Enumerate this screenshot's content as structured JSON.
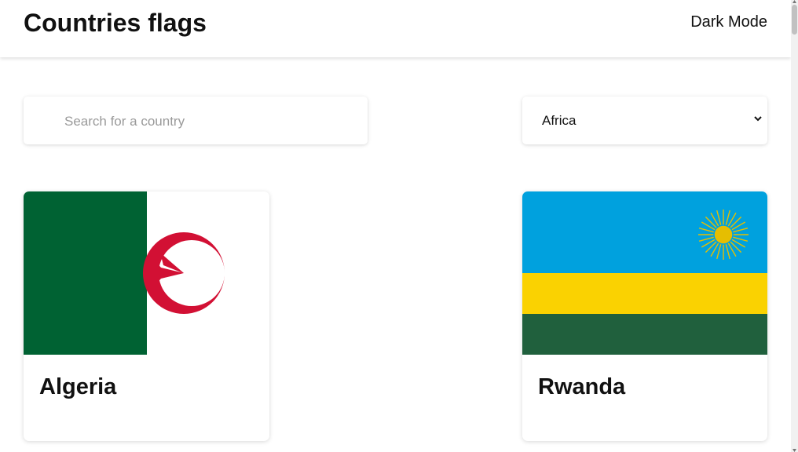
{
  "header": {
    "title": "Countries flags",
    "dark_mode_label": "Dark Mode"
  },
  "search": {
    "placeholder": "Search for a country",
    "value": ""
  },
  "filter": {
    "selected": "Africa"
  },
  "countries": [
    {
      "name": "Algeria",
      "flag_icon": "algeria-flag"
    },
    {
      "name": "Rwanda",
      "flag_icon": "rwanda-flag"
    }
  ],
  "colors": {
    "algeria_green": "#006233",
    "algeria_red": "#d21034",
    "rwanda_blue": "#00a1de",
    "rwanda_yellow": "#fad201",
    "rwanda_green": "#20603d",
    "rwanda_sun": "#e5be01"
  }
}
